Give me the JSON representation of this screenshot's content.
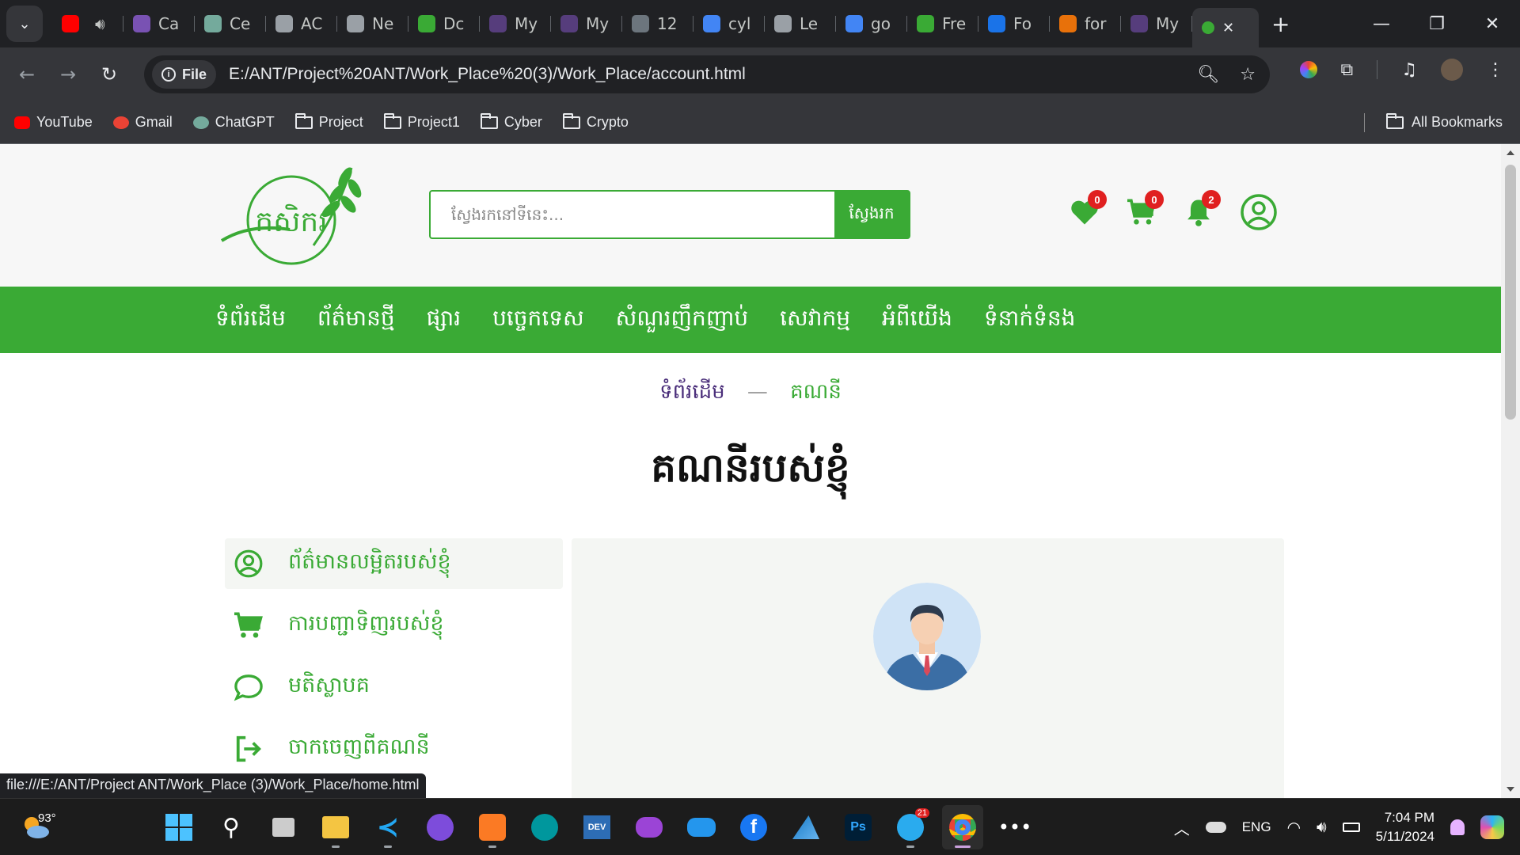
{
  "browser": {
    "tabs": [
      {
        "label": "",
        "icon": "youtube-icon",
        "color": "#ff0000"
      },
      {
        "label": "Ca",
        "icon": "bootstrap-icon",
        "color": "#7952b3"
      },
      {
        "label": "Ce",
        "icon": "chatgpt-icon",
        "color": "#74aa9c"
      },
      {
        "label": "AC",
        "icon": "globe-icon",
        "color": "#9aa0a6"
      },
      {
        "label": "Ne",
        "icon": "chrome-icon",
        "color": "#9aa0a6"
      },
      {
        "label": "Dc",
        "icon": "cube-icon",
        "color": "#3aaa35"
      },
      {
        "label": "My",
        "icon": "bootstrap-icon",
        "color": "#563d7c"
      },
      {
        "label": "My",
        "icon": "bootstrap-icon",
        "color": "#563d7c"
      },
      {
        "label": "12",
        "icon": "bootstrap-icon",
        "color": "#6c757d"
      },
      {
        "label": "cyl",
        "icon": "google-icon",
        "color": "#4285f4"
      },
      {
        "label": "Le",
        "icon": "globe-icon",
        "color": "#9aa0a6"
      },
      {
        "label": "go",
        "icon": "google-icon",
        "color": "#4285f4"
      },
      {
        "label": "Fre",
        "icon": "robot-icon",
        "color": "#3aaa35"
      },
      {
        "label": "Fo",
        "icon": "flag-icon",
        "color": "#1a73e8"
      },
      {
        "label": "for",
        "icon": "code-icon",
        "color": "#e8710a"
      },
      {
        "label": "My",
        "icon": "bootstrap-icon",
        "color": "#563d7c"
      }
    ],
    "active_tab_icon": "leaf-icon",
    "url_chip": "File",
    "url": "E:/ANT/Project%20ANT/Work_Place%20(3)/Work_Place/account.html",
    "bookmarks": [
      {
        "label": "YouTube",
        "icon": "youtube-icon"
      },
      {
        "label": "Gmail",
        "icon": "gmail-icon"
      },
      {
        "label": "ChatGPT",
        "icon": "chatgpt-icon"
      },
      {
        "label": "Project",
        "icon": "folder-icon"
      },
      {
        "label": "Project1",
        "icon": "folder-icon"
      },
      {
        "label": "Cyber",
        "icon": "folder-icon"
      },
      {
        "label": "Crypto",
        "icon": "folder-icon"
      }
    ],
    "all_bookmarks": "All Bookmarks",
    "status_url": "file:///E:/ANT/Project ANT/Work_Place (3)/Work_Place/home.html"
  },
  "site": {
    "logo_text": "កសិករ",
    "search": {
      "placeholder": "ស្វែងរកនៅទីនេះ...",
      "button": "ស្វែងរក"
    },
    "badges": {
      "wishlist": "0",
      "cart": "0",
      "notifications": "2"
    },
    "nav": [
      "ទំព័រដើម",
      "ព័ត៌មានថ្មី",
      "ផ្សារ",
      "បច្ចេកទេស",
      "សំណួរញឹកញាប់",
      "សេវាកម្ម",
      "អំពីយើង",
      "ទំនាក់ទំនង"
    ],
    "breadcrumb": {
      "home": "ទំព័រដើម",
      "separator": "—",
      "current": "គណនី"
    },
    "page_title": "គណនីរបស់ខ្ញុំ",
    "sidebar": [
      {
        "label": "ព័ត៌មានលម្អិតរបស់ខ្ញុំ",
        "icon": "user-circle-icon"
      },
      {
        "label": "ការបញ្ជាទិញរបស់ខ្ញុំ",
        "icon": "cart-icon"
      },
      {
        "label": "មតិស្លាបគ",
        "icon": "comment-icon"
      },
      {
        "label": "ចាកចេញពីគណនី",
        "icon": "logout-icon"
      }
    ],
    "accent_color": "#3aaa35"
  },
  "taskbar": {
    "temperature": "93°",
    "language": "ENG",
    "time": "7:04 PM",
    "date": "5/11/2024",
    "telegram_badge": "21"
  }
}
